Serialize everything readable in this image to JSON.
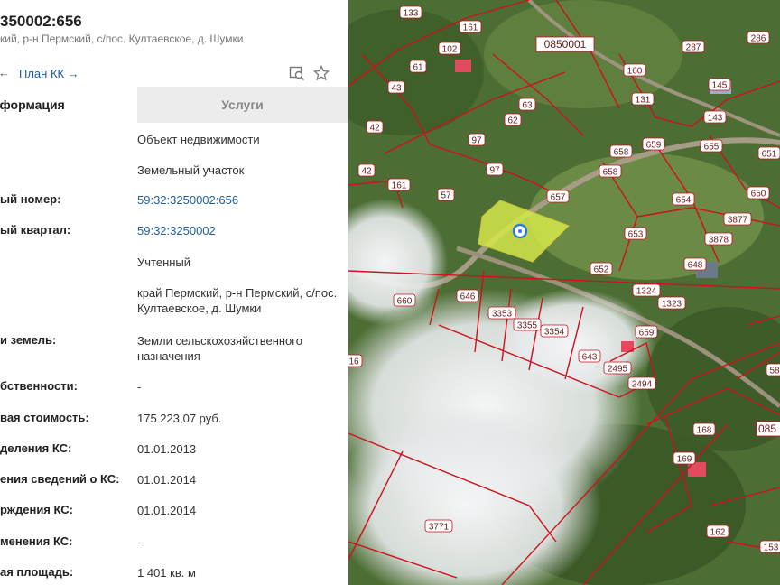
{
  "header": {
    "cadastral_title": "350002:656",
    "address_line": "кий, р-н Пермский, с/пос. Култаевское, д. Шумки"
  },
  "toolbar": {
    "back_arrow": "←",
    "plan_link": "План КК →",
    "icons": [
      "search-map-icon",
      "star-icon"
    ]
  },
  "tabs": {
    "info": "нформация",
    "services": "Услуги"
  },
  "rows": [
    {
      "label": "",
      "value": "Объект недвижимости"
    },
    {
      "label": "",
      "value": "Земельный участок"
    },
    {
      "label": "ый номер:",
      "value": "59:32:3250002:656"
    },
    {
      "label": "ый квартал:",
      "value": "59:32:3250002"
    },
    {
      "label": "",
      "value": "Учтенный"
    },
    {
      "label": "",
      "value": "край Пермский, р-н Пермский, с/пос. Култаевское, д. Шумки"
    },
    {
      "label": "и земель:",
      "value": "Земли сельскохозяйственного назначения"
    },
    {
      "label": "бственности:",
      "value": "-"
    },
    {
      "label": "вая стоимость:",
      "value": "175 223,07 руб."
    },
    {
      "label": "деления КС:",
      "value": "01.01.2013"
    },
    {
      "label": "ения сведений о КС:",
      "value": "01.01.2014"
    },
    {
      "label": "рждения КС:",
      "value": "01.01.2014"
    },
    {
      "label": "менения КС:",
      "value": "-"
    },
    {
      "label": "ая площадь:",
      "value": "1 401 кв. м"
    }
  ],
  "map": {
    "quarter_label_top": "0850001",
    "quarter_label_right": "085",
    "plot_labels": [
      "133",
      "161",
      "102",
      "286",
      "287",
      "145",
      "61",
      "63",
      "43",
      "62",
      "160",
      "131",
      "143",
      "42",
      "97",
      "658",
      "659",
      "655",
      "651",
      "42",
      "161",
      "97",
      "657",
      "654",
      "650",
      "57",
      "658",
      "653",
      "3877",
      "3878",
      "652",
      "648",
      "660",
      "646",
      "3353",
      "3355",
      "3354",
      "1324",
      "1323",
      "16",
      "643",
      "659",
      "2495",
      "2494",
      "58",
      "168",
      "169",
      "162",
      "153",
      "3771"
    ],
    "colors": {
      "selected_fill": "#d4e84a",
      "boundary": "#d0101c"
    }
  }
}
